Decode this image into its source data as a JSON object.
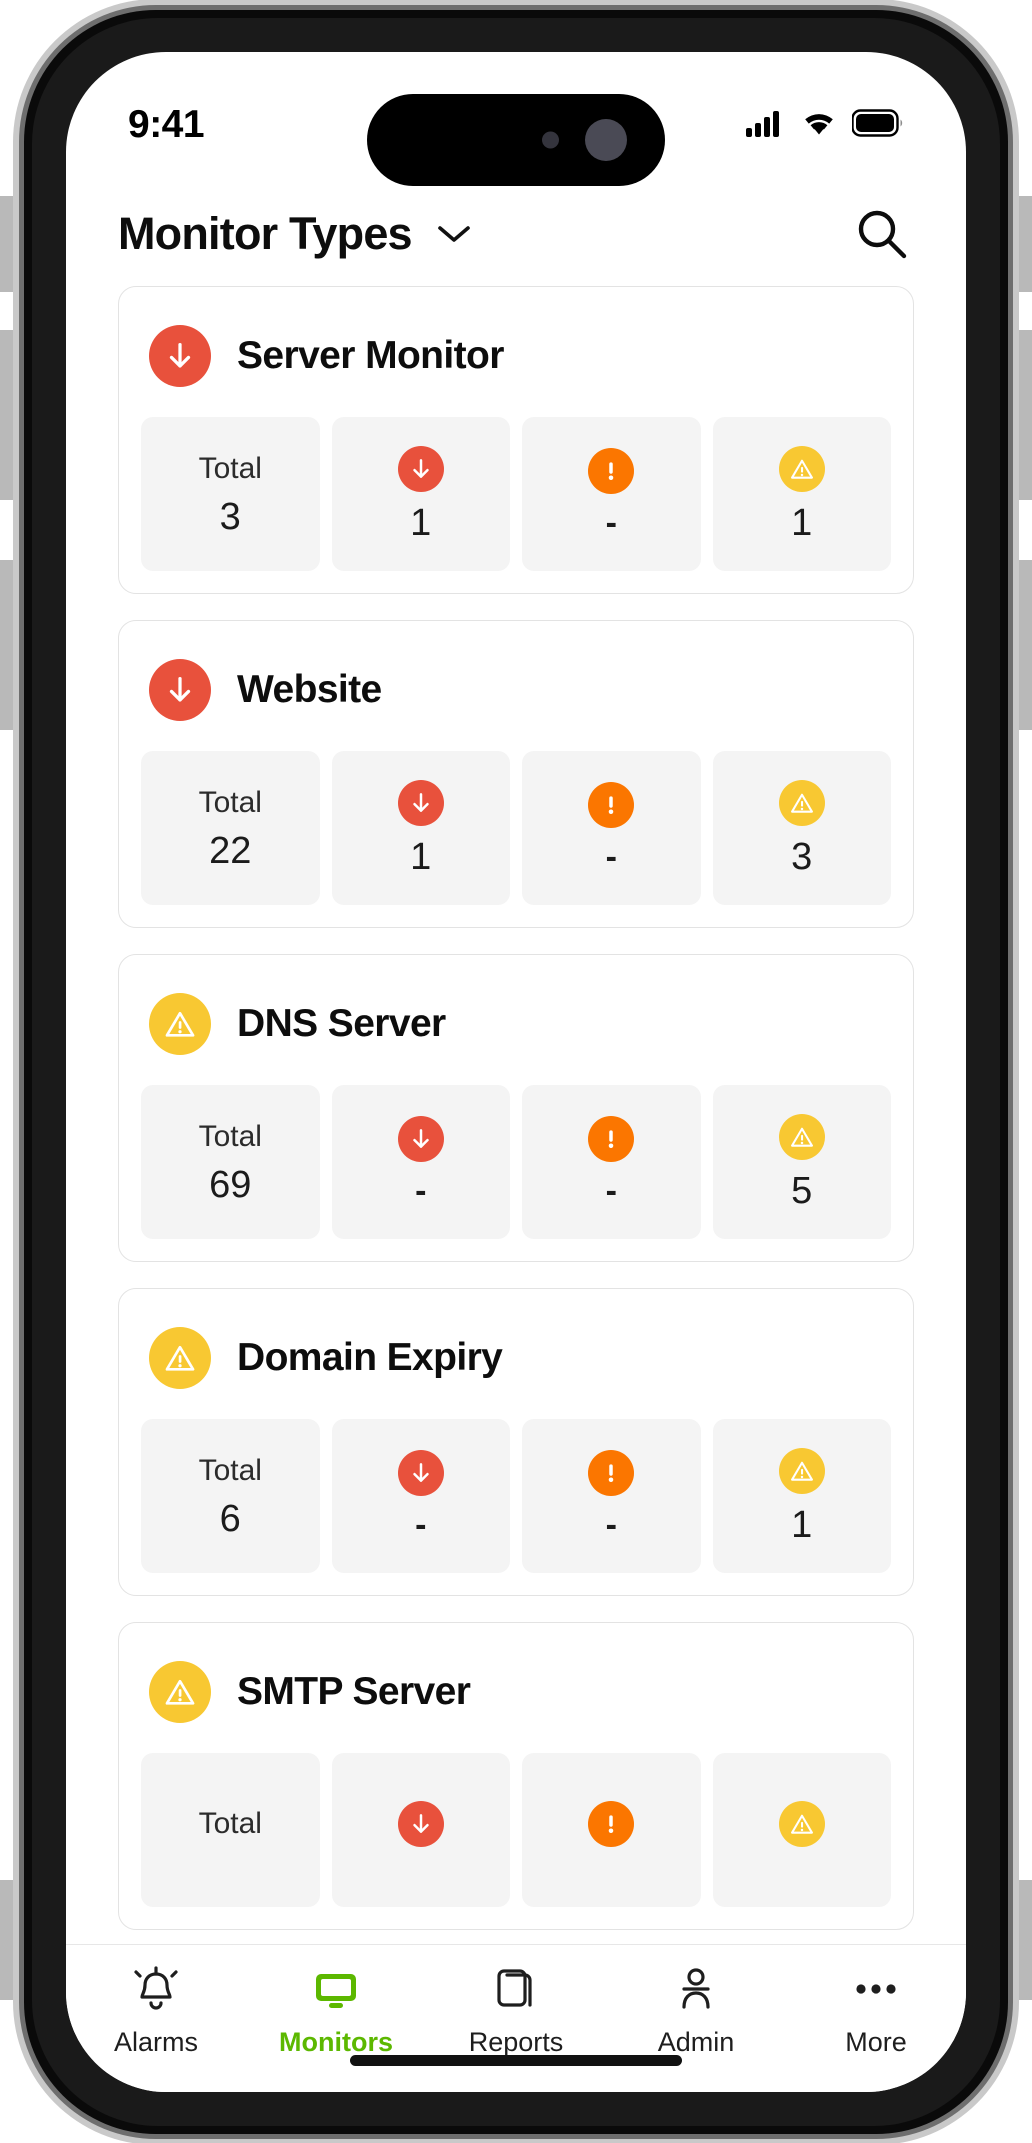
{
  "status_bar": {
    "time": "9:41",
    "icons": [
      "cellular-signal-icon",
      "wifi-icon",
      "battery-icon"
    ]
  },
  "header": {
    "title": "Monitor Types",
    "chevron_icon": "chevron-down-icon",
    "search_icon": "search-icon"
  },
  "colors": {
    "down": "#e8513c",
    "trouble": "#fb7600",
    "warning": "#f8c832",
    "accent": "#5cb800",
    "cell_bg": "#f4f4f4",
    "card_border": "#e3e3e3"
  },
  "stat_columns": [
    {
      "key": "total",
      "label": "Total",
      "icon": null
    },
    {
      "key": "down",
      "label": "",
      "icon": "down-arrow-circle-icon"
    },
    {
      "key": "trouble",
      "label": "",
      "icon": "exclamation-circle-icon"
    },
    {
      "key": "warning",
      "label": "",
      "icon": "warning-triangle-circle-icon"
    }
  ],
  "cards": [
    {
      "title": "Server Monitor",
      "status_icon": "down-arrow-circle-icon",
      "status": "down",
      "total_label": "Total",
      "stats": {
        "total": "3",
        "down": "1",
        "trouble": "-",
        "warning": "1"
      }
    },
    {
      "title": "Website",
      "status_icon": "down-arrow-circle-icon",
      "status": "down",
      "total_label": "Total",
      "stats": {
        "total": "22",
        "down": "1",
        "trouble": "-",
        "warning": "3"
      }
    },
    {
      "title": "DNS Server",
      "status_icon": "warning-triangle-circle-icon",
      "status": "warning",
      "total_label": "Total",
      "stats": {
        "total": "69",
        "down": "-",
        "trouble": "-",
        "warning": "5"
      }
    },
    {
      "title": "Domain Expiry",
      "status_icon": "warning-triangle-circle-icon",
      "status": "warning",
      "total_label": "Total",
      "stats": {
        "total": "6",
        "down": "-",
        "trouble": "-",
        "warning": "1"
      }
    },
    {
      "title": "SMTP Server",
      "status_icon": "warning-triangle-circle-icon",
      "status": "warning",
      "total_label": "Total",
      "stats": {
        "total": "",
        "down": "",
        "trouble": "",
        "warning": ""
      }
    }
  ],
  "tabbar": {
    "active_index": 1,
    "items": [
      {
        "label": "Alarms",
        "icon": "alarm-bell-icon"
      },
      {
        "label": "Monitors",
        "icon": "monitor-screen-icon"
      },
      {
        "label": "Reports",
        "icon": "reports-document-icon"
      },
      {
        "label": "Admin",
        "icon": "admin-person-icon"
      },
      {
        "label": "More",
        "icon": "more-ellipsis-icon"
      }
    ]
  }
}
